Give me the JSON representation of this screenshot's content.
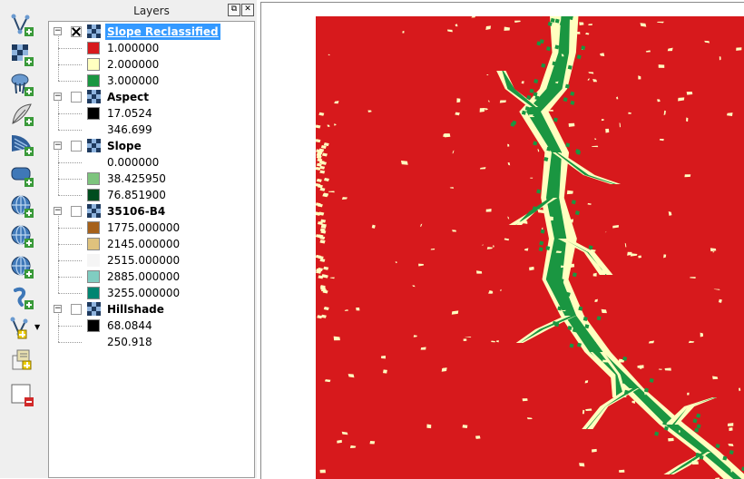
{
  "panel": {
    "title": "Layers",
    "float_button": "⧉",
    "close_button": "✕"
  },
  "toolbar": {
    "items": [
      {
        "name": "add-vector-layer-icon"
      },
      {
        "name": "add-raster-layer-icon"
      },
      {
        "name": "add-postgis-layer-icon"
      },
      {
        "name": "add-spatialite-layer-icon"
      },
      {
        "name": "add-mssql-layer-icon"
      },
      {
        "name": "add-oracle-layer-icon"
      },
      {
        "name": "add-wms-layer-icon"
      },
      {
        "name": "add-wcs-layer-icon"
      },
      {
        "name": "add-wfs-layer-icon"
      },
      {
        "name": "add-delimited-text-layer-icon"
      },
      {
        "name": "new-shapefile-layer-icon"
      },
      {
        "name": "new-spatialite-layer-icon"
      },
      {
        "name": "remove-layer-icon"
      }
    ],
    "dropdown_arrow": "▼"
  },
  "layers": [
    {
      "name": "Slope Reclassified",
      "checked": true,
      "selected": true,
      "classes": [
        {
          "color": "#d7191c",
          "label": "1.000000"
        },
        {
          "color": "#ffffc0",
          "label": "2.000000"
        },
        {
          "color": "#1a9641",
          "label": "3.000000"
        }
      ]
    },
    {
      "name": "Aspect",
      "checked": false,
      "selected": false,
      "classes": [
        {
          "color": "#000000",
          "label": "17.0524"
        },
        {
          "color": "#ffffff",
          "label": "346.699"
        }
      ]
    },
    {
      "name": "Slope",
      "checked": false,
      "selected": false,
      "classes": [
        {
          "color": "#ffffff",
          "label": "0.000000"
        },
        {
          "color": "#7dc47d",
          "label": "38.425950"
        },
        {
          "color": "#004d1f",
          "label": "76.851900"
        }
      ]
    },
    {
      "name": "35106-B4",
      "checked": false,
      "selected": false,
      "classes": [
        {
          "color": "#a6611a",
          "label": "1775.000000"
        },
        {
          "color": "#dfc27d",
          "label": "2145.000000"
        },
        {
          "color": "#f5f5f5",
          "label": "2515.000000"
        },
        {
          "color": "#80cdc1",
          "label": "2885.000000"
        },
        {
          "color": "#018571",
          "label": "3255.000000"
        }
      ]
    },
    {
      "name": "Hillshade",
      "checked": false,
      "selected": false,
      "classes": [
        {
          "color": "#000000",
          "label": "68.0844"
        },
        {
          "color": "#ffffff",
          "label": "250.918"
        }
      ]
    }
  ],
  "map": {
    "colors": {
      "class1": "#d7191c",
      "class2": "#ffffc0",
      "class3": "#1a9641"
    }
  }
}
